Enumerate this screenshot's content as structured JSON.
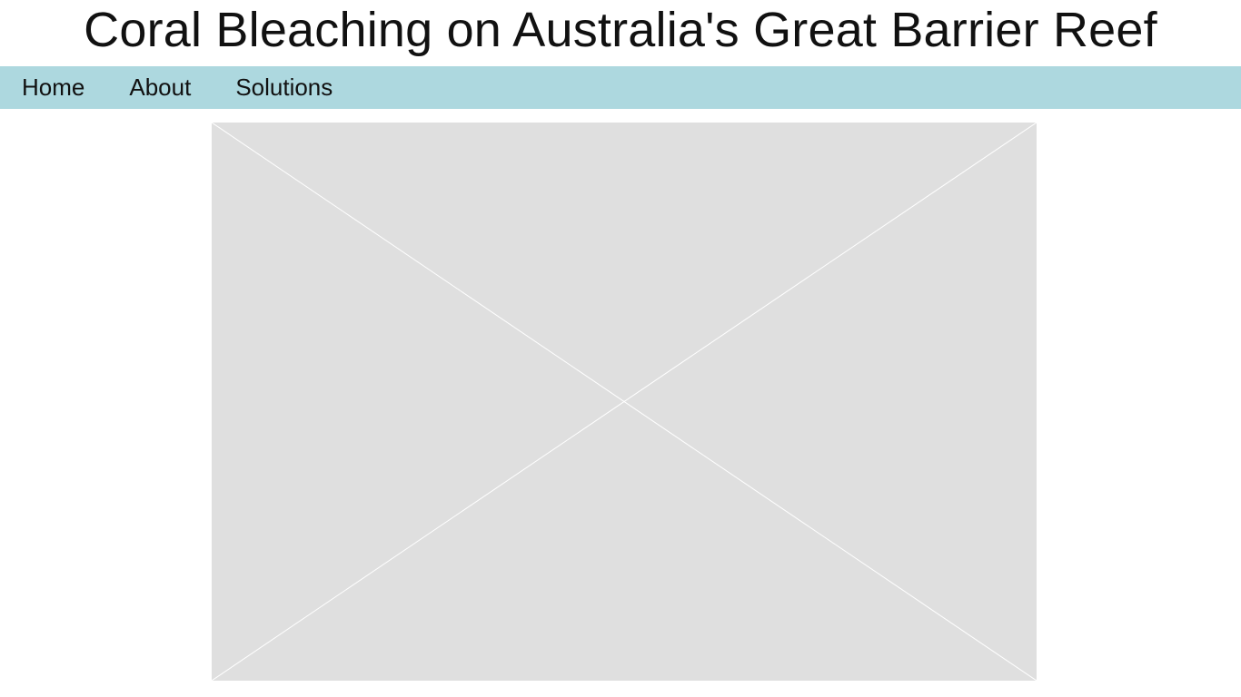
{
  "header": {
    "title": "Coral Bleaching on Australia's Great Barrier Reef"
  },
  "nav": {
    "items": [
      {
        "label": "Home"
      },
      {
        "label": "About"
      },
      {
        "label": "Solutions"
      }
    ],
    "background_color": "#add8df"
  },
  "main": {
    "image": {
      "kind": "placeholder",
      "fill_color": "#dfdfdf",
      "line_color": "#ffffff"
    }
  }
}
